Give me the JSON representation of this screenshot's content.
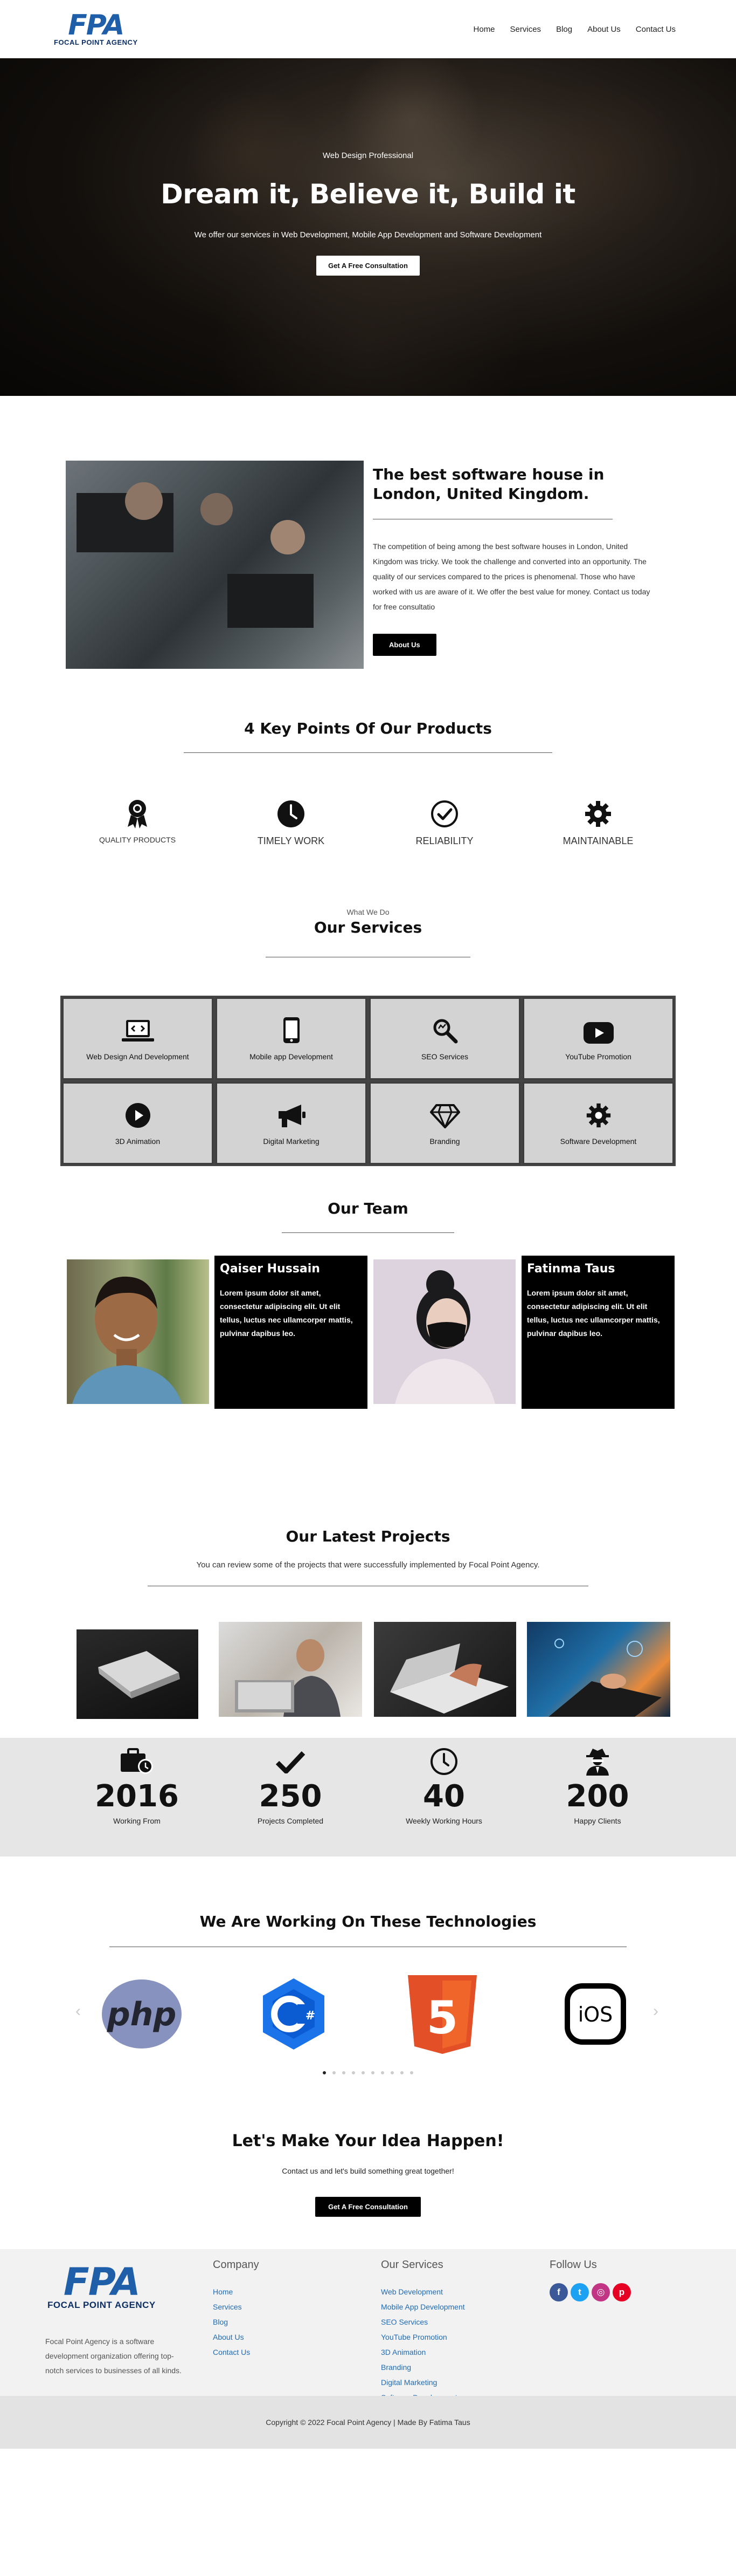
{
  "brand": {
    "logo_mark": "FPA",
    "logo_text": "FOCAL POINT AGENCY"
  },
  "nav": {
    "items": [
      "Home",
      "Services",
      "Blog",
      "About Us",
      "Contact Us"
    ]
  },
  "hero": {
    "kicker": "Web Design Professional",
    "title": "Dream it, Believe it, Build it",
    "subtitle": "We offer our services in Web Development, Mobile App Development and Software Development",
    "button": "Get A Free Consultation"
  },
  "about": {
    "title": "The best software house in London, United Kingdom.",
    "body": "The competition of being among the best software houses in London, United Kingdom was tricky. We took the challenge and converted into an opportunity. The quality of our services compared to the prices is phenomenal. Those who have worked with us are aware of it. We offer the best value for money. Contact us today for free consultatio",
    "button": "About Us"
  },
  "keypoints": {
    "title": "4 Key Points Of Our Products",
    "items": [
      {
        "icon": "award-icon",
        "label": "Quality Products"
      },
      {
        "icon": "clock-icon",
        "label": "Timely Work"
      },
      {
        "icon": "check-circle-icon",
        "label": "Reliability"
      },
      {
        "icon": "gear-icon",
        "label": "Maintainable"
      }
    ]
  },
  "services": {
    "kicker": "What We Do",
    "title": "Our Services",
    "items": [
      {
        "icon": "laptop-code-icon",
        "label": "Web Design And Development"
      },
      {
        "icon": "mobile-icon",
        "label": "Mobile app Development"
      },
      {
        "icon": "search-icon",
        "label": "SEO Services"
      },
      {
        "icon": "youtube-icon",
        "label": "YouTube Promotion"
      },
      {
        "icon": "play-circle-icon",
        "label": "3D Animation"
      },
      {
        "icon": "bullhorn-icon",
        "label": "Digital Marketing"
      },
      {
        "icon": "gem-icon",
        "label": "Branding"
      },
      {
        "icon": "gear-icon",
        "label": "Software Development"
      }
    ]
  },
  "team": {
    "title": "Our Team",
    "members": [
      {
        "name": "Qaiser Hussain",
        "bio": "Lorem ipsum dolor sit amet, consectetur adipiscing elit. Ut elit tellus, luctus nec ullamcorper mattis, pulvinar dapibus leo."
      },
      {
        "name": "Fatinma Taus",
        "bio": "Lorem ipsum dolor sit amet, consectetur adipiscing elit. Ut elit tellus, luctus nec ullamcorper mattis, pulvinar dapibus leo."
      }
    ]
  },
  "projects": {
    "title": "Our Latest Projects",
    "subtitle": "You can review some of the projects that were successfully implemented by Focal Point Agency."
  },
  "stats": {
    "items": [
      {
        "icon": "briefcase-clock-icon",
        "value": "2016",
        "label": "Working From"
      },
      {
        "icon": "check-icon",
        "value": "250",
        "label": "Projects Completed"
      },
      {
        "icon": "clock-icon",
        "value": "40",
        "label": "Weekly Working Hours"
      },
      {
        "icon": "user-secret-icon",
        "value": "200",
        "label": "Happy Clients"
      }
    ]
  },
  "tech": {
    "title": "We Are Working On These Technologies",
    "logos": [
      {
        "icon": "php-logo",
        "text": "php"
      },
      {
        "icon": "csharp-logo",
        "text": "C#"
      },
      {
        "icon": "html5-logo",
        "text": "5"
      },
      {
        "icon": "ios-logo",
        "text": "iOS"
      }
    ],
    "prev": "‹",
    "next": "›",
    "dots": 10,
    "active_dot": 0
  },
  "cta": {
    "title": "Let's Make Your Idea Happen!",
    "subtitle": "Contact us and let's build something great together!",
    "button": "Get A Free Consultation"
  },
  "footer": {
    "about": "Focal Point Agency is a software development organization offering top-notch services to businesses of all kinds.",
    "company": {
      "title": "Company",
      "links": [
        "Home",
        "Services",
        "Blog",
        "About Us",
        "Contact Us"
      ]
    },
    "services": {
      "title": "Our Services",
      "links": [
        "Web Development",
        "Mobile App Development",
        "SEO Services",
        "YouTube Promotion",
        "3D Animation",
        "Branding",
        "Digital Marketing",
        "Software Development"
      ]
    },
    "follow": {
      "title": "Follow Us",
      "socials": [
        {
          "icon": "facebook-icon",
          "glyph": "f",
          "color": "#3b5998"
        },
        {
          "icon": "twitter-icon",
          "glyph": "t",
          "color": "#1da1f2"
        },
        {
          "icon": "instagram-icon",
          "glyph": "◎",
          "color": "#c13584"
        },
        {
          "icon": "pinterest-icon",
          "glyph": "p",
          "color": "#e60023"
        }
      ]
    },
    "copyright": "Copyright © 2022 Focal Point Agency | Made By Fatima Taus"
  }
}
